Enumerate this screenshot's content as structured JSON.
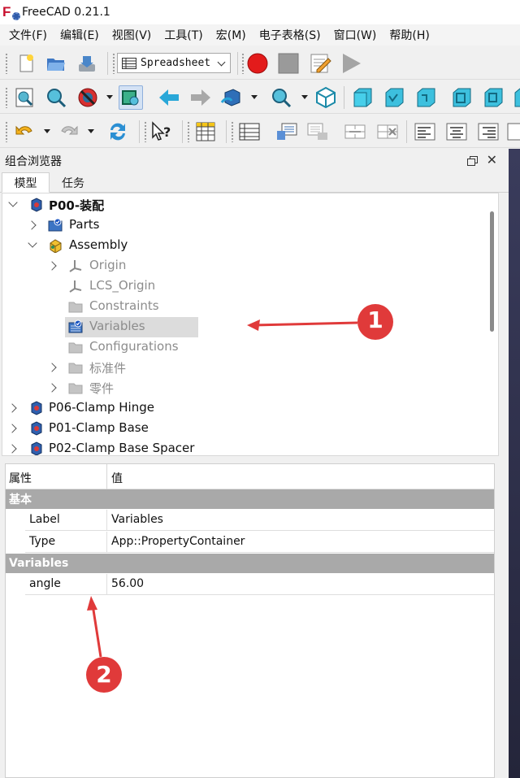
{
  "window": {
    "title": "FreeCAD 0.21.1"
  },
  "menu": [
    "文件(F)",
    "编辑(E)",
    "视图(V)",
    "工具(T)",
    "宏(M)",
    "电子表格(S)",
    "窗口(W)",
    "帮助(H)"
  ],
  "toolbar": {
    "workbench_selector": "Spreadsheet"
  },
  "combo_view": {
    "title": "组合浏览器",
    "tabs": [
      "模型",
      "任务"
    ],
    "tree": [
      {
        "label": "P00-装配"
      },
      {
        "label": "Parts"
      },
      {
        "label": "Assembly"
      },
      {
        "label": "Origin"
      },
      {
        "label": "LCS_Origin"
      },
      {
        "label": "Constraints"
      },
      {
        "label": "Variables"
      },
      {
        "label": "Configurations"
      },
      {
        "label": "标准件"
      },
      {
        "label": "零件"
      },
      {
        "label": "P06-Clamp Hinge"
      },
      {
        "label": "P01-Clamp Base"
      },
      {
        "label": "P02-Clamp Base Spacer"
      }
    ]
  },
  "property_editor": {
    "header": {
      "property": "属性",
      "value": "值"
    },
    "groups": [
      {
        "name": "基本",
        "rows": [
          {
            "key": "Label",
            "value": "Variables"
          },
          {
            "key": "Type",
            "value": "App::PropertyContainer"
          }
        ]
      },
      {
        "name": "Variables",
        "rows": [
          {
            "key": "angle",
            "value": "56.00"
          }
        ]
      }
    ]
  },
  "annotations": [
    "1",
    "2"
  ],
  "colors": {
    "annotation_red": "#e03a3a",
    "brand_red": "#c8102e",
    "group_gray": "#a9a9a9"
  }
}
